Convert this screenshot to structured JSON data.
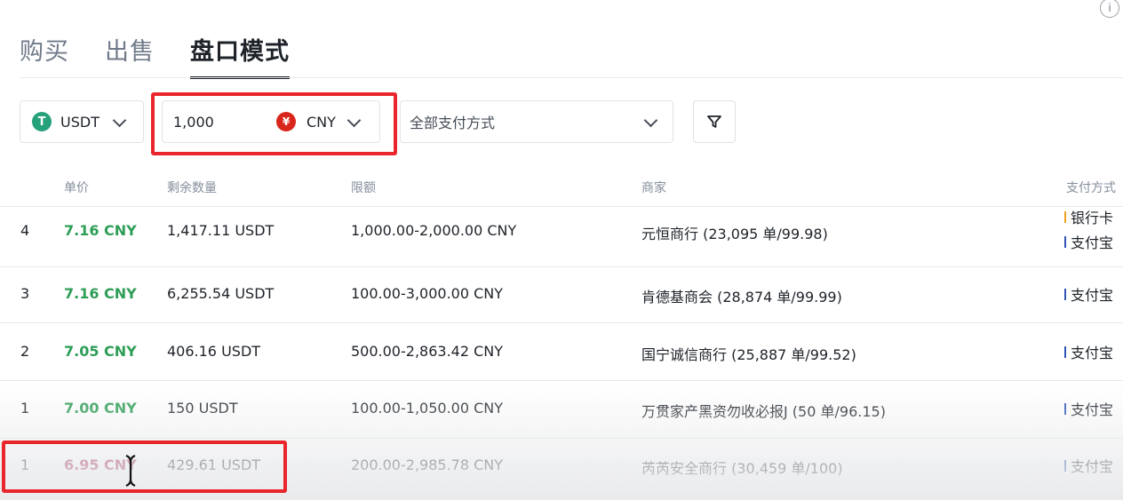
{
  "tabs": [
    "购买",
    "出售",
    "盘口模式"
  ],
  "active_tab": "盘口模式",
  "filters": {
    "coin": "USDT",
    "coin_icon": "tether-icon",
    "amount": "1,000",
    "currency": "CNY",
    "currency_icon": "yuan-icon",
    "payment_method": "全部支付方式"
  },
  "table": {
    "headers": {
      "price": "单价",
      "quantity": "剩余数量",
      "limit": "限额",
      "merchant": "商家",
      "payment": "支付方式"
    },
    "rows": [
      {
        "index": "4",
        "price": "7.16 CNY",
        "quantity": "1,417.11 USDT",
        "limit": "1,000.00-2,000.00 CNY",
        "merchant": "元恒商行 (23,095 单/99.98)",
        "payments": [
          "银行卡",
          "支付宝"
        ]
      },
      {
        "index": "3",
        "price": "7.16 CNY",
        "quantity": "6,255.54 USDT",
        "limit": "100.00-3,000.00 CNY",
        "merchant": "肯德基商会 (28,874 单/99.99)",
        "payments": [
          "支付宝"
        ]
      },
      {
        "index": "2",
        "price": "7.05 CNY",
        "quantity": "406.16 USDT",
        "limit": "500.00-2,863.42 CNY",
        "merchant": "国宁诚信商行 (25,887 单/99.52)",
        "payments": [
          "支付宝"
        ]
      },
      {
        "index": "1",
        "price": "7.00 CNY",
        "quantity": "150 USDT",
        "limit": "100.00-1,050.00 CNY",
        "merchant": "万贯家产黑资勿收必报J (50 单/96.15)",
        "payments": [
          "支付宝"
        ]
      },
      {
        "index": "1",
        "price": "6.95 CNY",
        "quantity": "429.61 USDT",
        "limit": "200.00-2,985.78 CNY",
        "merchant": "芮芮安全商行 (30,459 单/100)",
        "payments": [
          "支付宝"
        ]
      }
    ]
  },
  "colors": {
    "buy_price": "#2e9e57",
    "sell_price": "#a3244f",
    "highlight": "#e8262b",
    "bank_card": "#f0a024",
    "alipay": "#2f54b5"
  }
}
